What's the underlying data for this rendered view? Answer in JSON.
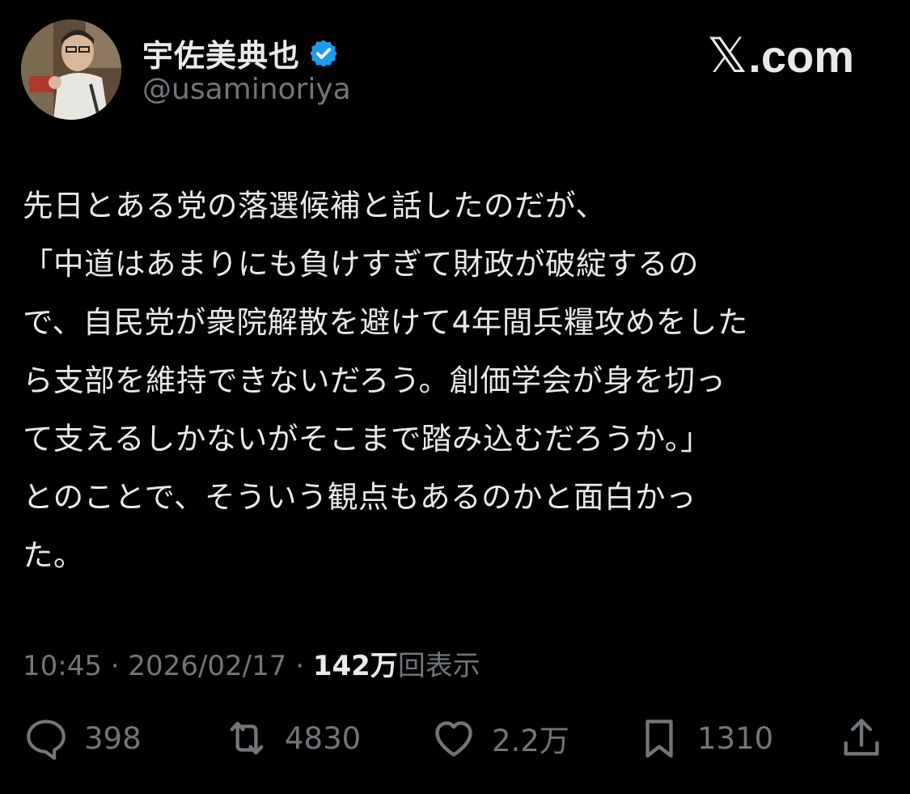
{
  "author": {
    "name": "宇佐美典也",
    "handle": "@usaminoriya",
    "verified_color": "#1d9bf0"
  },
  "site": {
    "x_glyph": "𝕏",
    "domain": ".com"
  },
  "tweet": {
    "text": "先日とある党の落選候補と話したのだが、\n「中道はあまりにも負けすぎて財政が破綻するの\nで、自民党が衆院解散を避けて4年間兵糧攻めをした\nら支部を維持できないだろう。創価学会が身を切っ\nて支えるしかないがそこまで踏み込むだろうか。」\nとのことで、そういう観点もあるのかと面白かっ\nた。"
  },
  "meta": {
    "time": "10:45",
    "sep1": " · ",
    "date": "2026/02/17",
    "sep2": " · ",
    "views_count": "142万",
    "views_label": "回表示"
  },
  "actions": {
    "reply_count": "398",
    "retweet_count": "4830",
    "like_count": "2.2万",
    "bookmark_count": "1310"
  },
  "icons": [
    "avatar",
    "verified-badge-icon",
    "reply-icon",
    "retweet-icon",
    "like-icon",
    "bookmark-icon",
    "share-icon"
  ],
  "colors": {
    "background": "#000000",
    "text": "#e7e9ea",
    "muted": "#71767b"
  }
}
